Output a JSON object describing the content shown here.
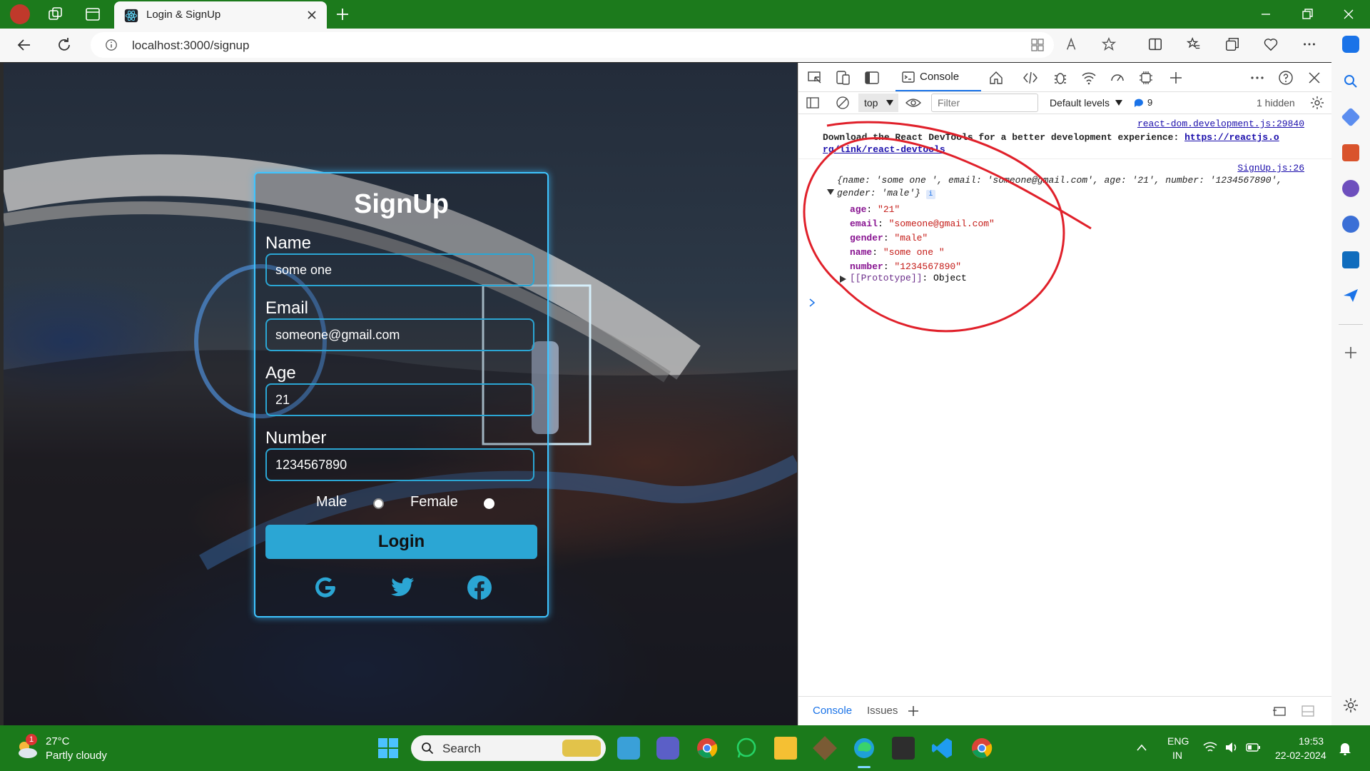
{
  "browser": {
    "tab_title": "Login & SignUp",
    "url": "localhost:3000/signup"
  },
  "form": {
    "title": "SignUp",
    "name_label": "Name",
    "name_value": "some one",
    "email_label": "Email",
    "email_value": "someone@gmail.com",
    "age_label": "Age",
    "age_value": "21",
    "number_label": "Number",
    "number_value": "1234567890",
    "male_label": "Male",
    "female_label": "Female",
    "login_label": "Login",
    "social_icons": [
      "google-icon",
      "twitter-icon",
      "facebook-icon"
    ]
  },
  "devtools": {
    "console_tab": "Console",
    "context": "top",
    "filter_placeholder": "Filter",
    "levels": "Default levels",
    "issue_count": "9",
    "hidden": "1 hidden",
    "log1_source": "react-dom.development.js:29840",
    "log1_text": "Download the React DevTools for a better development experience: ",
    "log1_link_a": "https://reactjs.o",
    "log1_link_b": "rg/link/react-devtools",
    "log2_source": "SignUp.js:26",
    "log2_summary_a": "{name: 'some one ', email: 'someone@gmail.com', age: '21', number: '1234567890',",
    "log2_summary_b": "gender: 'male'}",
    "props": [
      {
        "key": "age",
        "value": "\"21\""
      },
      {
        "key": "email",
        "value": "\"someone@gmail.com\""
      },
      {
        "key": "gender",
        "value": "\"male\""
      },
      {
        "key": "name",
        "value": "\"some one \""
      },
      {
        "key": "number",
        "value": "\"1234567890\""
      }
    ],
    "prototype_key": "[[Prototype]]",
    "prototype_value": "Object",
    "bottom_tab_console": "Console",
    "bottom_tab_issues": "Issues"
  },
  "taskbar": {
    "weather_temp": "27°C",
    "weather_desc": "Partly cloudy",
    "weather_badge": "1",
    "search_placeholder": "Search",
    "lang_top": "ENG",
    "lang_bottom": "IN",
    "time": "19:53",
    "date": "22-02-2024"
  },
  "colors": {
    "accent": "#2ba6d4",
    "taskbar": "#1b7a1b",
    "annotation": "#e0202a"
  }
}
